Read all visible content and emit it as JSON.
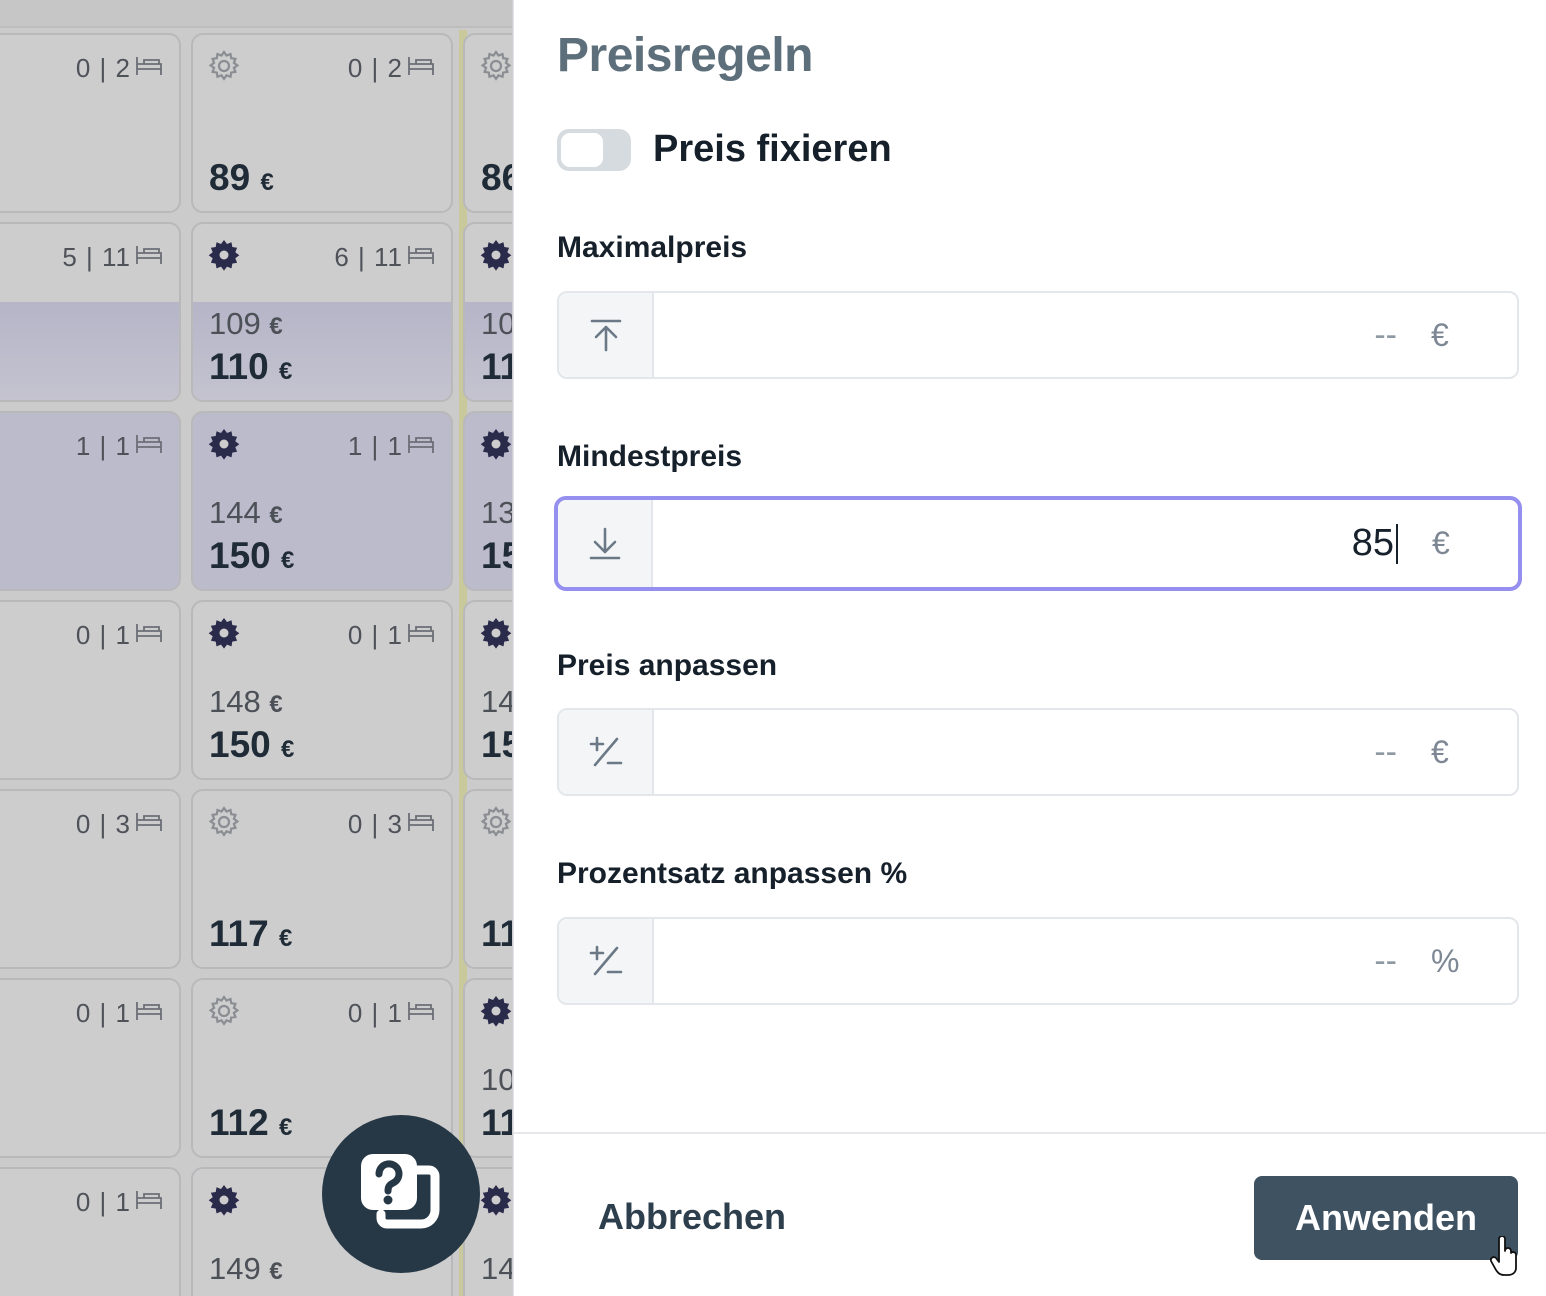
{
  "grid": {
    "columns": [
      {
        "cells": [
          {
            "icon": "none",
            "occupancy": "0 | 2",
            "old_price": "",
            "price": "",
            "band": false,
            "full": false
          },
          {
            "icon": "none",
            "occupancy": "5 | 11",
            "old_price": "",
            "price": "€",
            "band": true,
            "full": false
          },
          {
            "icon": "none",
            "occupancy": "1 | 1",
            "old_price": "",
            "price": "€",
            "band": false,
            "full": true
          },
          {
            "icon": "none",
            "occupancy": "0 | 1",
            "old_price": "",
            "price": "€",
            "band": false,
            "full": false
          },
          {
            "icon": "none",
            "occupancy": "0 | 3",
            "old_price": "",
            "price": "€",
            "band": false,
            "full": false
          },
          {
            "icon": "none",
            "occupancy": "0 | 1",
            "old_price": "",
            "price": "€",
            "band": false,
            "full": false
          },
          {
            "icon": "none",
            "occupancy": "0 | 1",
            "old_price": "",
            "price": "",
            "band": false,
            "full": false
          }
        ]
      },
      {
        "cells": [
          {
            "icon": "gear-outline",
            "occupancy": "0 | 2",
            "old_price": "",
            "price": "89",
            "band": false,
            "full": false
          },
          {
            "icon": "gear-filled",
            "occupancy": "6 | 11",
            "old_price": "109",
            "price": "110",
            "band": true,
            "full": false
          },
          {
            "icon": "gear-filled",
            "occupancy": "1 | 1",
            "old_price": "144",
            "price": "150",
            "band": false,
            "full": true
          },
          {
            "icon": "gear-filled",
            "occupancy": "0 | 1",
            "old_price": "148",
            "price": "150",
            "band": false,
            "full": false
          },
          {
            "icon": "gear-outline",
            "occupancy": "0 | 3",
            "old_price": "",
            "price": "117",
            "band": false,
            "full": false
          },
          {
            "icon": "gear-outline",
            "occupancy": "0 | 1",
            "old_price": "",
            "price": "112",
            "band": false,
            "full": false
          },
          {
            "icon": "gear-filled",
            "occupancy": "",
            "old_price": "149",
            "price": "",
            "band": false,
            "full": false
          }
        ]
      },
      {
        "cells": [
          {
            "icon": "gear-outline",
            "occupancy": "",
            "old_price": "",
            "price": "86",
            "band": false,
            "full": false
          },
          {
            "icon": "gear-filled",
            "occupancy": "",
            "old_price": "10",
            "price": "11",
            "band": true,
            "full": false
          },
          {
            "icon": "gear-filled",
            "occupancy": "",
            "old_price": "13",
            "price": "15",
            "band": false,
            "full": true
          },
          {
            "icon": "gear-filled",
            "occupancy": "",
            "old_price": "14",
            "price": "15",
            "band": false,
            "full": false
          },
          {
            "icon": "gear-outline",
            "occupancy": "",
            "old_price": "",
            "price": "11",
            "band": false,
            "full": false
          },
          {
            "icon": "gear-filled",
            "occupancy": "",
            "old_price": "10",
            "price": "11",
            "band": false,
            "full": false
          },
          {
            "icon": "gear-filled",
            "occupancy": "",
            "old_price": "14",
            "price": "",
            "band": false,
            "full": false
          }
        ]
      }
    ],
    "currency": "€"
  },
  "panel": {
    "title": "Preisregeln",
    "toggle": {
      "label": "Preis fixieren",
      "checked": false
    },
    "fields": {
      "max": {
        "label": "Maximalpreis",
        "value": "",
        "placeholder": "--",
        "unit": "€",
        "icon": "arrow-up-to-line-icon"
      },
      "min": {
        "label": "Mindestpreis",
        "value": "85",
        "placeholder": "--",
        "unit": "€",
        "icon": "arrow-down-to-line-icon"
      },
      "adjust": {
        "label": "Preis anpassen",
        "value": "",
        "placeholder": "--",
        "unit": "€",
        "icon": "plus-minus-icon"
      },
      "percent": {
        "label": "Prozentsatz anpassen %",
        "value": "",
        "placeholder": "--",
        "unit": "%",
        "icon": "plus-minus-icon"
      }
    },
    "footer": {
      "cancel_label": "Abbrechen",
      "apply_label": "Anwenden"
    }
  },
  "colors": {
    "accent_focus": "#958ff0",
    "primary_button": "#3e5262",
    "help_bubble": "#263746"
  }
}
